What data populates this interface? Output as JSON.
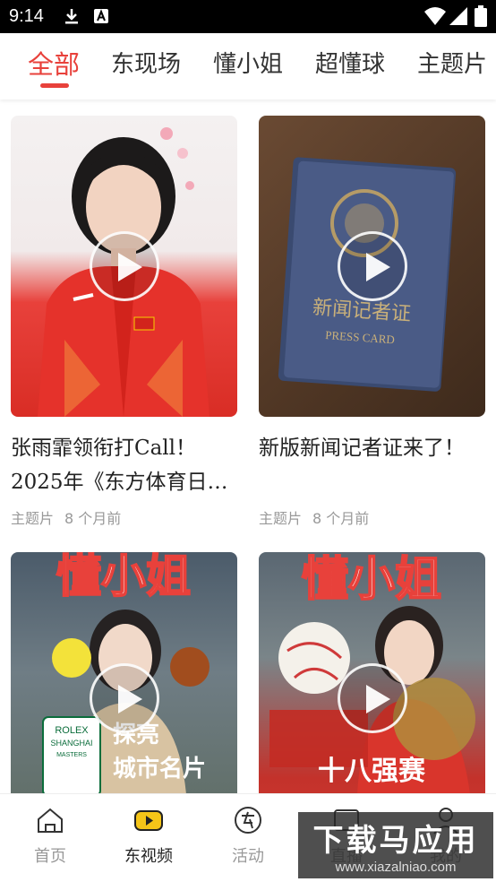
{
  "status_bar": {
    "time": "9:14"
  },
  "tabs": [
    {
      "label": "全部",
      "active": true
    },
    {
      "label": "东现场",
      "active": false
    },
    {
      "label": "懂小姐",
      "active": false
    },
    {
      "label": "超懂球",
      "active": false
    },
    {
      "label": "主题片",
      "active": false
    }
  ],
  "cards": [
    {
      "title": "张雨霏领衔打Call！2025年《东方体育日…",
      "category": "主题片",
      "time": "8 个月前",
      "thumb_text": []
    },
    {
      "title": "新版新闻记者证来了！",
      "category": "主题片",
      "time": "8 个月前",
      "thumb_text": [
        "新闻记者证",
        "PRESS CARD"
      ]
    },
    {
      "title": "",
      "category": "",
      "time": "",
      "thumb_text": [
        "懂小姐",
        "ROLEX",
        "SHANGHAI",
        "MASTERS",
        "探亮",
        "城市名片"
      ]
    },
    {
      "title": "",
      "category": "",
      "time": "",
      "thumb_text": [
        "懂小姐",
        "十八强赛"
      ]
    }
  ],
  "bottom_nav": [
    {
      "label": "首页",
      "icon": "home-icon",
      "active": false
    },
    {
      "label": "东视频",
      "icon": "video-icon",
      "active": true
    },
    {
      "label": "活动",
      "icon": "activity-icon",
      "active": false
    },
    {
      "label": "直播",
      "icon": "live-icon",
      "active": false
    },
    {
      "label": "我的",
      "icon": "profile-icon",
      "active": false
    }
  ],
  "watermark": {
    "title": "下载马应用",
    "url": "www.xiazalniao.com"
  },
  "colors": {
    "accent": "#e8413b",
    "nav_active_icon": "#f5c518"
  }
}
